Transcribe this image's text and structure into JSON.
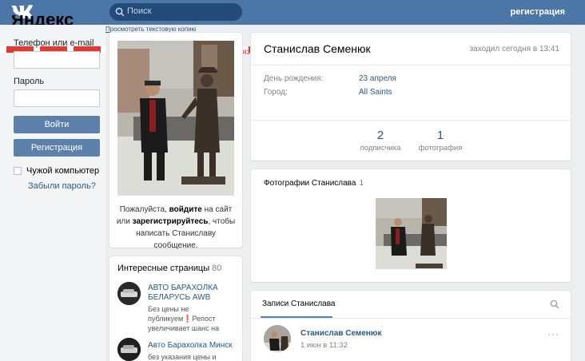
{
  "header": {
    "search_placeholder": "Поиск",
    "register_link": "регистрация"
  },
  "ad": {
    "brand_partial": "Яндекс",
    "fragment": "яз"
  },
  "login": {
    "phone_label": "Телефон или e-mail",
    "password_label": "Пароль",
    "login_button": "Войти",
    "register_button": "Регистрация",
    "foreign_computer": "Чужой компьютер",
    "forgot_password": "Забыли пароль?"
  },
  "copy_link": "Просмотреть текстовую копию",
  "photo_block": {
    "note_1": "Пожалуйста, ",
    "note_login": "войдите",
    "note_2": " на сайт или ",
    "note_register": "зарегистрируйтесь",
    "note_3": ", чтобы написать Станиславу сообщение."
  },
  "interests": {
    "title": "Интересные страницы",
    "count": "80",
    "groups": [
      {
        "name": "АВТО БАРАХОЛКА БЕЛАРУСЬ AWB",
        "desc_1": "Без цены не публикуем",
        "desc_mark": "❗",
        "desc_2": "Репост увеличивает шанс на"
      },
      {
        "name": "Авто Барахолка Минск",
        "desc": "без указания цены и"
      }
    ]
  },
  "profile": {
    "name": "Станислав Семенюк",
    "last_seen": "заходил сегодня в 13:41",
    "birthday_label": "День рождения:",
    "birthday_value": "23 апреля",
    "city_label": "Город:",
    "city_value": "All Saints",
    "counters": [
      {
        "value": "2",
        "label": "подписчика"
      },
      {
        "value": "1",
        "label": "фотография"
      }
    ]
  },
  "photos": {
    "title": "Фотографии Станислава",
    "count": "1"
  },
  "posts": {
    "tab": "Записи Станислава",
    "author": "Станислав Семенюк",
    "date": "1 июн в 11:32",
    "more": "···"
  },
  "colors": {
    "header_blue": "#4a76a8",
    "button_blue": "#5b80aa",
    "link_blue": "#2a5885",
    "ad_red": "#e3392f"
  }
}
